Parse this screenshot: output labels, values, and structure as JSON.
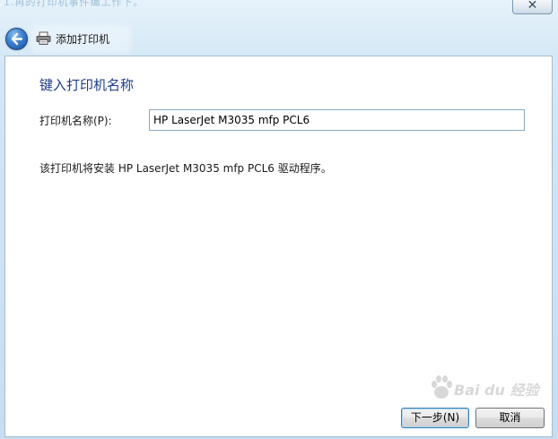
{
  "window": {
    "ghost_title": "1.再的打印机事件编工作下。",
    "title": "添加打印机",
    "close_symbol": "✕"
  },
  "page": {
    "heading": "键入打印机名称",
    "printer_name_label": "打印机名称(P):",
    "printer_name_value": "HP LaserJet M3035 mfp PCL6",
    "driver_info": "该打印机将安装 HP LaserJet M3035 mfp PCL6 驱动程序。"
  },
  "buttons": {
    "next": "下一步(N)",
    "cancel": "取消"
  },
  "icons": {
    "back": "back-arrow-icon",
    "printer": "printer-icon",
    "close": "close-icon"
  },
  "watermark": {
    "text": "Bai du 经验"
  },
  "colors": {
    "heading": "#1e3b87",
    "chrome": "#cfe3f1",
    "back_button": "#3a7fcf"
  }
}
